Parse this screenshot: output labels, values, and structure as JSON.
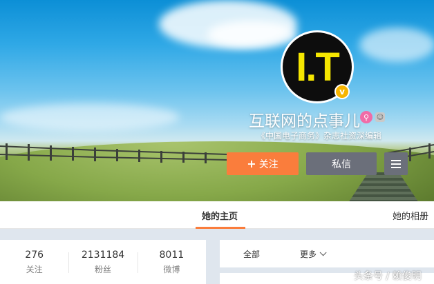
{
  "profile": {
    "avatar_text": "I.T",
    "nickname": "互联网的点事儿",
    "description": "《中国电子商务》杂志社资深编辑",
    "verified_mark": "v"
  },
  "actions": {
    "follow_label": "关注",
    "message_label": "私信"
  },
  "tabs": [
    {
      "label": "她的主页"
    },
    {
      "label": "她的相册"
    }
  ],
  "counts": [
    {
      "value": "276",
      "label": "关注"
    },
    {
      "value": "2131184",
      "label": "粉丝"
    },
    {
      "value": "8011",
      "label": "微博"
    }
  ],
  "filter": {
    "all_label": "全部",
    "more_label": "更多"
  },
  "watermark": {
    "text": "头条号 / 赖俊明"
  },
  "colors": {
    "accent": "#fa7d3c",
    "button_gray": "#6b6f7a",
    "verified": "#f7b500"
  }
}
